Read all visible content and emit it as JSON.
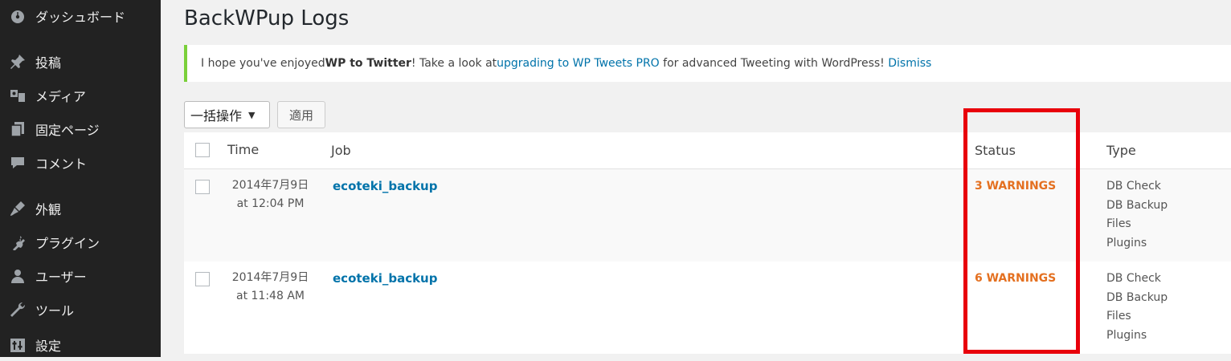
{
  "sidebar": {
    "items": [
      {
        "label": "ダッシュボード",
        "icon": "dashboard-icon"
      },
      {
        "label": "投稿",
        "icon": "pin-icon"
      },
      {
        "label": "メディア",
        "icon": "media-icon"
      },
      {
        "label": "固定ページ",
        "icon": "pages-icon"
      },
      {
        "label": "コメント",
        "icon": "comment-icon"
      },
      {
        "label": "外観",
        "icon": "appearance-icon"
      },
      {
        "label": "プラグイン",
        "icon": "plugin-icon"
      },
      {
        "label": "ユーザー",
        "icon": "user-icon"
      },
      {
        "label": "ツール",
        "icon": "wrench-icon"
      },
      {
        "label": "設定",
        "icon": "settings-icon"
      }
    ]
  },
  "page": {
    "title": "BackWPup Logs"
  },
  "notice": {
    "prefix": "I hope you've enjoyed ",
    "plugin": "WP to Twitter",
    "middle": "! Take a look at ",
    "link": "upgrading to WP Tweets PRO",
    "suffix": " for advanced Tweeting with WordPress! ",
    "dismiss": "Dismiss"
  },
  "bulk": {
    "selected": "一括操作",
    "arrow": "▼",
    "apply": "適用"
  },
  "table": {
    "headers": {
      "time": "Time",
      "job": "Job",
      "status": "Status",
      "type": "Type"
    },
    "rows": [
      {
        "date": "2014年7月9日",
        "time": "at 12:04 PM",
        "job": "ecoteki_backup",
        "status": "3 WARNINGS",
        "types": [
          "DB Check",
          "DB Backup",
          "Files",
          "Plugins"
        ]
      },
      {
        "date": "2014年7月9日",
        "time": "at 11:48 AM",
        "job": "ecoteki_backup",
        "status": "6 WARNINGS",
        "types": [
          "DB Check",
          "DB Backup",
          "Files",
          "Plugins"
        ]
      }
    ]
  },
  "colors": {
    "highlight": "#e8000b",
    "warning": "#e47020",
    "link": "#0073aa",
    "notice_border": "#7ad03a"
  }
}
